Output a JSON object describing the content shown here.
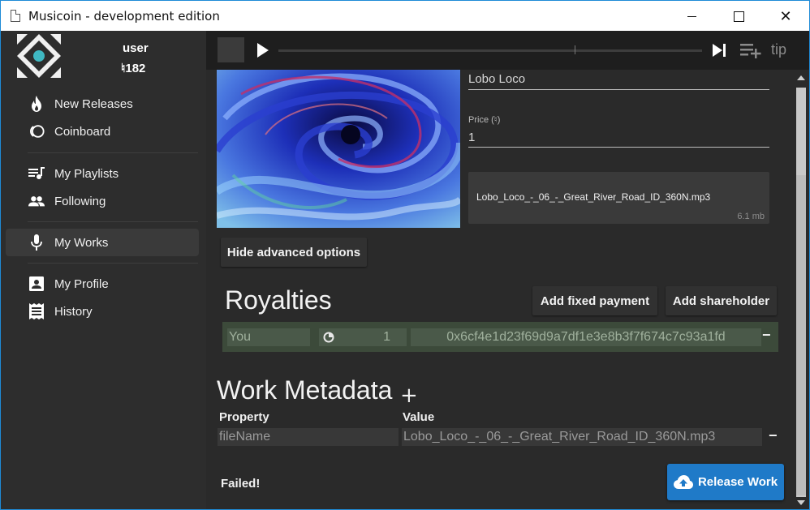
{
  "window": {
    "title": "Musicoin - development edition",
    "close_glyph": "✕"
  },
  "user": {
    "name": "user",
    "balance": "♮182"
  },
  "sidebar": {
    "items": [
      {
        "label": "New Releases",
        "icon": "fire-icon"
      },
      {
        "label": "Coinboard",
        "icon": "coins-icon"
      },
      {
        "label": "My Playlists",
        "icon": "playlist-icon"
      },
      {
        "label": "Following",
        "icon": "people-icon"
      },
      {
        "label": "My Works",
        "icon": "microphone-icon",
        "active": true
      },
      {
        "label": "My Profile",
        "icon": "profile-card-icon"
      },
      {
        "label": "History",
        "icon": "receipt-icon"
      }
    ]
  },
  "player": {
    "tip_label": "tip"
  },
  "release_form": {
    "title_value": "Lobo Loco",
    "price_label": "Price (♮)",
    "price_value": "1",
    "file_name": "Lobo_Loco_-_06_-_Great_River_Road_ID_360N.mp3",
    "file_size": "6.1 mb",
    "hide_advanced_label": "Hide advanced options"
  },
  "royalties": {
    "title": "Royalties",
    "add_fixed_label": "Add fixed payment",
    "add_shareholder_label": "Add shareholder",
    "rows": [
      {
        "name": "You",
        "share": "1",
        "address": "0x6cf4e1d23f69d9a7df1e3e8b3f7f674c7c93a1fd"
      }
    ]
  },
  "metadata": {
    "title": "Work Metadata",
    "add_glyph": "+",
    "property_header": "Property",
    "value_header": "Value",
    "rows": [
      {
        "property": "fileName",
        "value": "Lobo_Loco_-_06_-_Great_River_Road_ID_360N.mp3"
      }
    ],
    "remove_glyph": "−"
  },
  "status": {
    "message": "Failed!"
  },
  "actions": {
    "release_label": "Release Work"
  },
  "colors": {
    "accent": "#1f7ac8",
    "window_border": "#1e8ad6",
    "royalty_row": "#3c4a3a"
  }
}
